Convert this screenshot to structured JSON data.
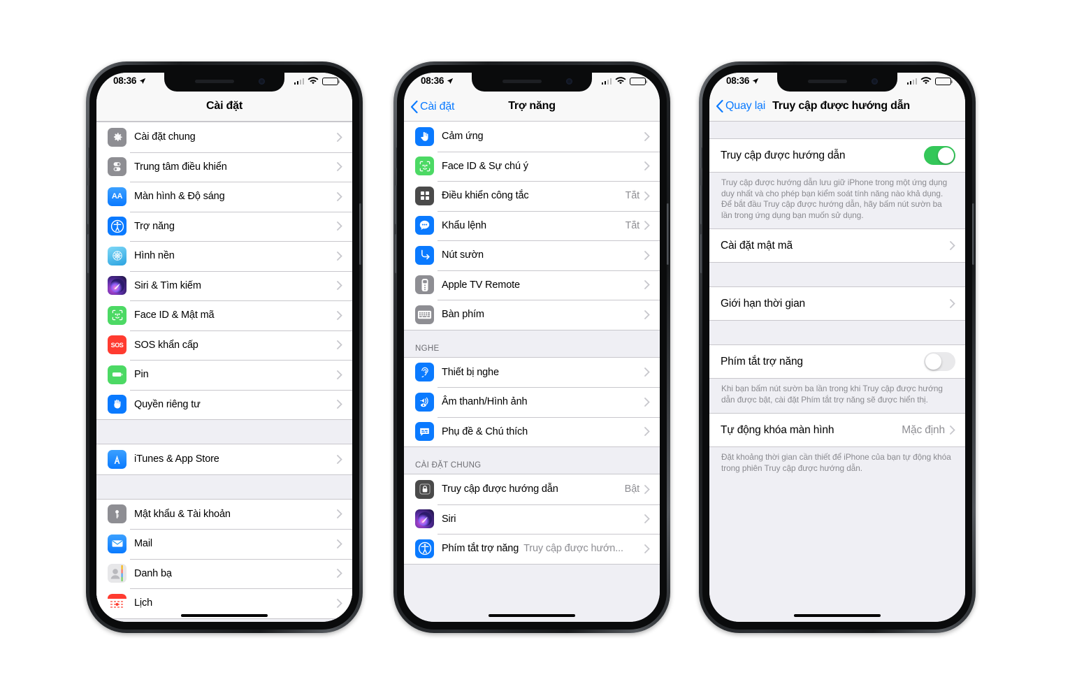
{
  "colors": {
    "accent_blue": "#0a7aff",
    "toggle_on_green": "#34c759",
    "list_bg": "#efeff4",
    "row_bg": "#ffffff",
    "separator": "#c8c7cc",
    "secondary_text": "#8e8e93"
  },
  "status_bar": {
    "time": "08:36",
    "location_icon": "location-arrow-icon",
    "signal_icon": "cellular-signal-icon",
    "wifi_icon": "wifi-icon",
    "battery_icon": "battery-icon"
  },
  "phone1": {
    "nav": {
      "title": "Cài đặt"
    },
    "groups": [
      {
        "rows": [
          {
            "label": "Cài đặt chung",
            "icon": "gear-icon",
            "icon_style": "plain-grey"
          },
          {
            "label": "Trung tâm điều khiển",
            "icon": "control-center-icon",
            "icon_style": "plain-grey"
          },
          {
            "label": "Màn hình & Độ sáng",
            "icon": "aa-display-icon",
            "icon_style": "grad-blue"
          },
          {
            "label": "Trợ năng",
            "icon": "accessibility-icon",
            "icon_style": "plain-blue"
          },
          {
            "label": "Hình nền",
            "icon": "wallpaper-icon",
            "icon_style": "grad-wall"
          },
          {
            "label": "Siri & Tìm kiếm",
            "icon": "siri-icon",
            "icon_style": "grad-siri"
          },
          {
            "label": "Face ID & Mật mã",
            "icon": "face-id-icon",
            "icon_style": "plain-green"
          },
          {
            "label": "SOS khẩn cấp",
            "icon": "sos-icon",
            "icon_style": "plain-red"
          },
          {
            "label": "Pin",
            "icon": "battery-settings-icon",
            "icon_style": "plain-green"
          },
          {
            "label": "Quyền riêng tư",
            "icon": "privacy-hand-icon",
            "icon_style": "plain-blue"
          }
        ]
      },
      {
        "rows": [
          {
            "label": "iTunes & App Store",
            "icon": "app-store-icon",
            "icon_style": "grad-blue"
          }
        ]
      },
      {
        "rows": [
          {
            "label": "Mật khẩu & Tài khoản",
            "icon": "passwords-key-icon",
            "icon_style": "plain-grey"
          },
          {
            "label": "Mail",
            "icon": "mail-icon",
            "icon_style": "grad-blue"
          },
          {
            "label": "Danh bạ",
            "icon": "contacts-icon",
            "icon_style": "plain-grey"
          },
          {
            "label": "Lịch",
            "icon": "calendar-icon",
            "icon_style": "plain-red"
          }
        ]
      }
    ]
  },
  "phone2": {
    "nav": {
      "back_label": "Cài đặt",
      "title": "Trợ năng"
    },
    "groups": [
      {
        "header": "",
        "rows": [
          {
            "label": "Cảm ứng",
            "value": "",
            "icon": "touch-hand-icon",
            "icon_style": "plain-blue"
          },
          {
            "label": "Face ID & Sự chú ý",
            "value": "",
            "icon": "face-id-icon",
            "icon_style": "plain-green"
          },
          {
            "label": "Điều khiển công tắc",
            "value": "Tắt",
            "icon": "switch-control-icon",
            "icon_style": "plain-dark"
          },
          {
            "label": "Khẩu lệnh",
            "value": "Tắt",
            "icon": "voice-control-icon",
            "icon_style": "plain-blue"
          },
          {
            "label": "Nút sườn",
            "value": "",
            "icon": "side-button-icon",
            "icon_style": "plain-blue"
          },
          {
            "label": "Apple TV Remote",
            "value": "",
            "icon": "apple-tv-remote-icon",
            "icon_style": "plain-grey"
          },
          {
            "label": "Bàn phím",
            "value": "",
            "icon": "keyboard-icon",
            "icon_style": "plain-grey"
          }
        ]
      },
      {
        "header": "NGHE",
        "rows": [
          {
            "label": "Thiết bị nghe",
            "value": "",
            "icon": "hearing-ear-icon",
            "icon_style": "plain-blue"
          },
          {
            "label": "Âm thanh/Hình ảnh",
            "value": "",
            "icon": "audio-visual-icon",
            "icon_style": "plain-blue"
          },
          {
            "label": "Phụ đề & Chú thích",
            "value": "",
            "icon": "subtitles-icon",
            "icon_style": "plain-blue"
          }
        ]
      },
      {
        "header": "CÀI ĐẶT CHUNG",
        "rows": [
          {
            "label": "Truy cập được hướng dẫn",
            "value": "Bật",
            "icon": "guided-access-lock-icon",
            "icon_style": "plain-dark"
          },
          {
            "label": "Siri",
            "value": "",
            "icon": "siri-icon",
            "icon_style": "grad-siri"
          },
          {
            "label": "Phím tắt trợ năng",
            "value": "Truy cập được hướn...",
            "icon": "accessibility-icon",
            "icon_style": "plain-blue"
          }
        ]
      }
    ]
  },
  "phone3": {
    "nav": {
      "back_label": "Quay lại",
      "title": "Truy cập được hướng dẫn"
    },
    "blocks": [
      {
        "type": "toggle_row",
        "label": "Truy cập được hướng dẫn",
        "state": "on"
      },
      {
        "type": "footnote",
        "text": "Truy cập được hướng dẫn lưu giữ iPhone trong một ứng dụng duy nhất và cho phép bạn kiểm soát tính năng nào khả dụng. Để bắt đầu Truy cập được hướng dẫn, hãy bấm nút sườn ba lần trong ứng dụng bạn muốn sử dụng."
      },
      {
        "type": "link_row",
        "label": "Cài đặt mật mã",
        "value": ""
      },
      {
        "type": "gap"
      },
      {
        "type": "link_row",
        "label": "Giới hạn thời gian",
        "value": ""
      },
      {
        "type": "gap"
      },
      {
        "type": "toggle_row",
        "label": "Phím tắt trợ năng",
        "state": "off"
      },
      {
        "type": "footnote",
        "text": "Khi bạn bấm nút sườn ba lần trong khi Truy cập được hướng dẫn được bật, cài đặt Phím tắt trợ năng sẽ được hiển thị."
      },
      {
        "type": "link_row",
        "label": "Tự động khóa màn hình",
        "value": "Mặc định"
      },
      {
        "type": "footnote",
        "text": "Đặt khoảng thời gian cần thiết để iPhone của bạn tự động khóa trong phiên Truy cập được hướng dẫn."
      }
    ]
  }
}
